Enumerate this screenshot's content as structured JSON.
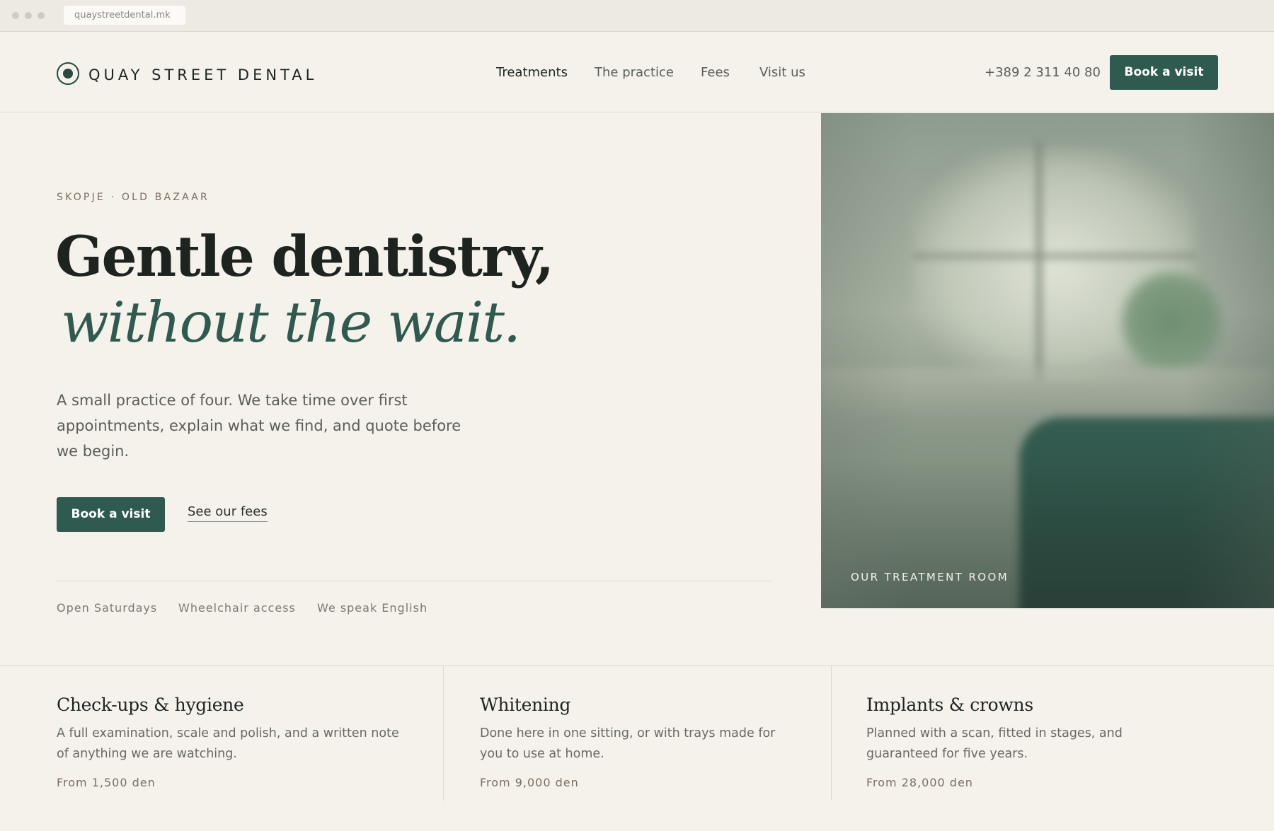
{
  "browser": {
    "url": "quaystreetdental.mk"
  },
  "header": {
    "logo_text": "QUAY STREET DENTAL",
    "nav": [
      "Treatments",
      "The practice",
      "Fees",
      "Visit us"
    ],
    "phone": "+389 2 311 40 80",
    "cta": "Book a visit"
  },
  "hero": {
    "eyebrow": "SKOPJE · OLD BAZAAR",
    "headline_line1": "Gentle dentistry,",
    "headline_line2": "without the wait.",
    "lead": "A small practice of four. We take time over first appointments, explain what we find, and quote before we begin.",
    "primary_cta": "Book a visit",
    "secondary_cta": "See our fees",
    "features": [
      "Open Saturdays",
      "Wheelchair access",
      "We speak English"
    ],
    "image_caption": "OUR TREATMENT ROOM"
  },
  "treatments": [
    {
      "title": "Check-ups & hygiene",
      "description": "A full examination, scale and polish, and a written note of anything we are watching.",
      "price": "From 1,500 den"
    },
    {
      "title": "Whitening",
      "description": "Done here in one sitting, or with trays made for you to use at home.",
      "price": "From 9,000 den"
    },
    {
      "title": "Implants & crowns",
      "description": "Planned with a scan, fitted in stages, and guaranteed for five years.",
      "price": "From 28,000 den"
    }
  ],
  "colors": {
    "accent": "#2e5a4f",
    "background": "#f5f2ec",
    "text": "#1d2420",
    "muted": "#7a6e60"
  }
}
